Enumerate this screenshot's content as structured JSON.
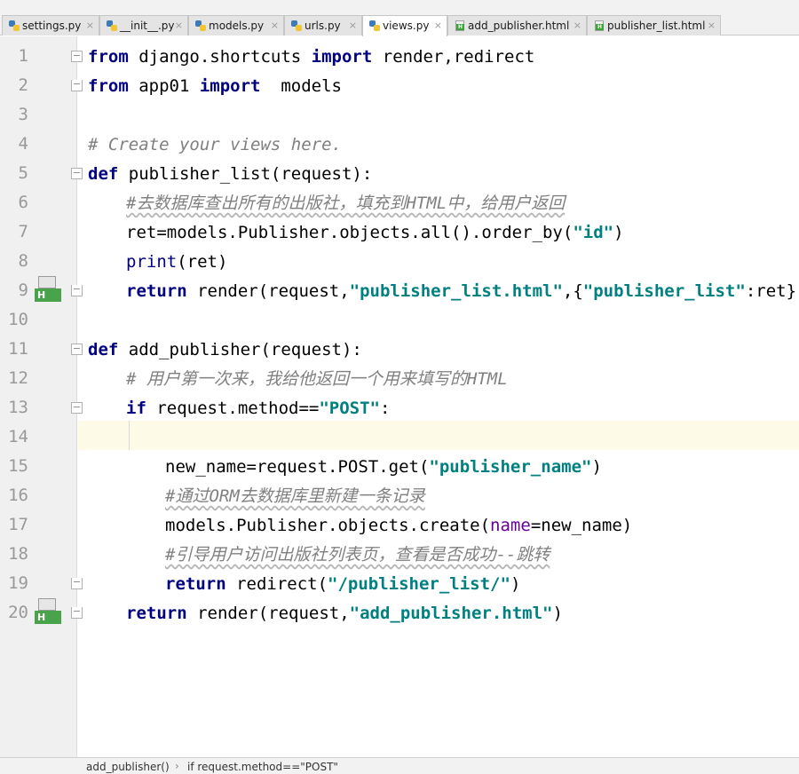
{
  "tabs": [
    {
      "label": "settings.py",
      "type": "py",
      "close": "×"
    },
    {
      "label": "__init__.py",
      "type": "py",
      "close": "×"
    },
    {
      "label": "models.py",
      "type": "py",
      "close": "×"
    },
    {
      "label": "urls.py",
      "type": "py",
      "close": "×"
    },
    {
      "label": "views.py",
      "type": "py",
      "close": "×",
      "active": true
    },
    {
      "label": "add_publisher.html",
      "type": "html",
      "close": "×"
    },
    {
      "label": "publisher_list.html",
      "type": "html",
      "close": "×"
    }
  ],
  "line_numbers": [
    "1",
    "2",
    "3",
    "4",
    "5",
    "6",
    "7",
    "8",
    "9",
    "10",
    "11",
    "12",
    "13",
    "14",
    "15",
    "16",
    "17",
    "18",
    "19",
    "20"
  ],
  "gutter_marker_label": "H",
  "code": {
    "l1": {
      "kw1": "from",
      "t1": " django.shortcuts ",
      "kw2": "import",
      "t2": " render,redirect"
    },
    "l2": {
      "kw1": "from",
      "t1": " app01 ",
      "kw2": "import",
      "t2": "  models"
    },
    "l4": {
      "c": "# Create your views here."
    },
    "l5": {
      "kw": "def",
      "t": " publisher_list(request):"
    },
    "l6": {
      "c": "#去数据库查出所有的出版社，填充到HTML中，给用户返回"
    },
    "l7": {
      "t1": "ret=models.Publisher.objects.all().order_by(",
      "s": "\"id\"",
      "t2": ")"
    },
    "l8": {
      "bi": "print",
      "t": "(ret)"
    },
    "l9": {
      "kw": "return",
      "t1": " render(request,",
      "s1": "\"publisher_list.html\"",
      "t2": ",{",
      "s2": "\"publisher_list\"",
      "t3": ":ret})"
    },
    "l11": {
      "kw": "def",
      "t": " add_publisher(request):"
    },
    "l12": {
      "c": "# 用户第一次来，我给他返回一个用来填写的HTML"
    },
    "l13": {
      "kw": "if",
      "t1": " request.method==",
      "s": "\"POST\"",
      "t2": ":"
    },
    "l15": {
      "t1": "new_name=request.POST.get(",
      "s": "\"publisher_name\"",
      "t2": ")"
    },
    "l16": {
      "c": "#通过ORM去数据库里新建一条记录"
    },
    "l17": {
      "t1": "models.Publisher.objects.create(",
      "p": "name",
      "t2": "=new_name)"
    },
    "l18": {
      "c": "#引导用户访问出版社列表页，查看是否成功--跳转"
    },
    "l19": {
      "kw": "return",
      "t1": " redirect(",
      "s": "\"/publisher_list/\"",
      "t2": ")"
    },
    "l20": {
      "kw": "return",
      "t1": " render(request,",
      "s": "\"add_publisher.html\"",
      "t2": ")"
    }
  },
  "breadcrumb": {
    "item1": "add_publisher()",
    "sep": "›",
    "item2": "if request.method==\"POST\""
  },
  "colors": {
    "keyword": "#000080",
    "string": "#008080",
    "comment": "#808080",
    "current_line": "#fdfbe8",
    "gutter": "#f0f0f0"
  }
}
